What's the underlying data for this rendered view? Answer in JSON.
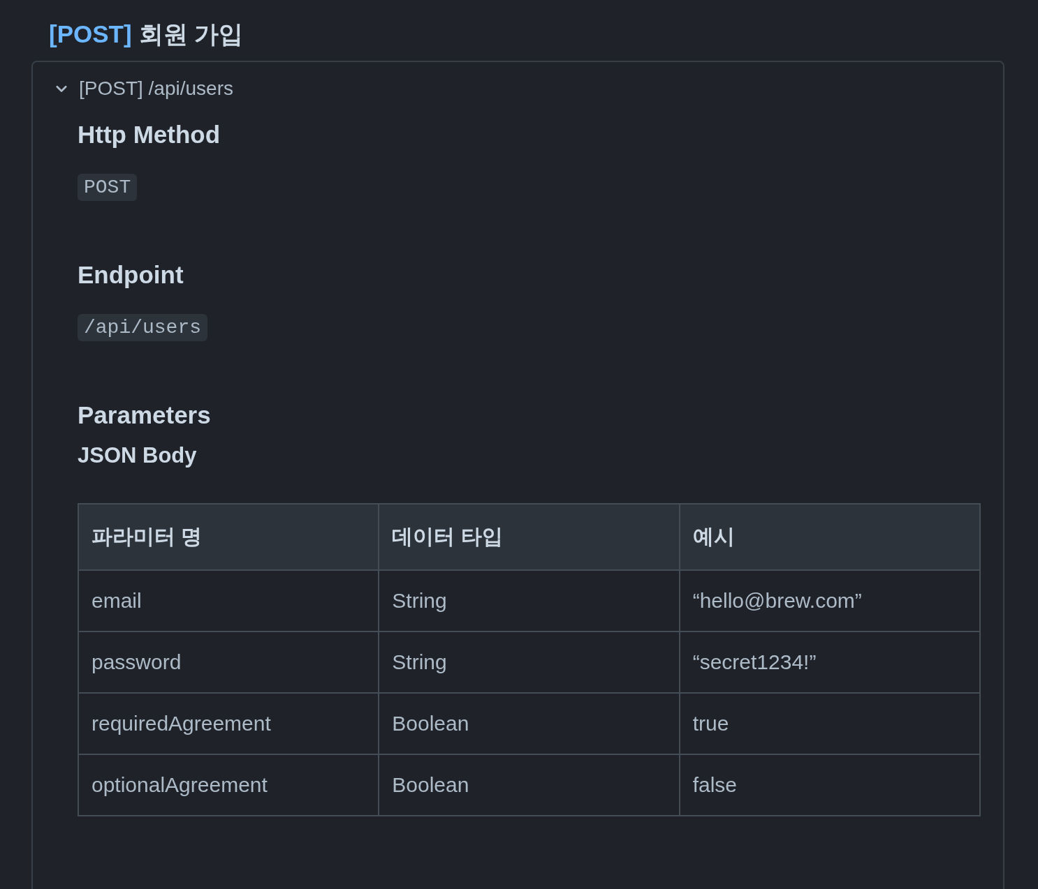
{
  "title": {
    "tag": "[POST]",
    "text": "회원 가입"
  },
  "details": {
    "summary": "[POST] /api/users",
    "expanded": true,
    "sections": [
      {
        "heading": "Http Method",
        "code": "POST"
      },
      {
        "heading": "Endpoint",
        "code": "/api/users"
      },
      {
        "heading": "Parameters"
      }
    ],
    "subheading": "JSON Body",
    "table": {
      "columns": [
        "파라미터 명",
        "데이터 타입",
        "예시"
      ],
      "rows": [
        [
          "email",
          "String",
          "“hello@brew.com”"
        ],
        [
          "password",
          "String",
          "“secret1234!”"
        ],
        [
          "requiredAgreement",
          "Boolean",
          "true"
        ],
        [
          "optionalAgreement",
          "Boolean",
          "false"
        ]
      ]
    }
  }
}
